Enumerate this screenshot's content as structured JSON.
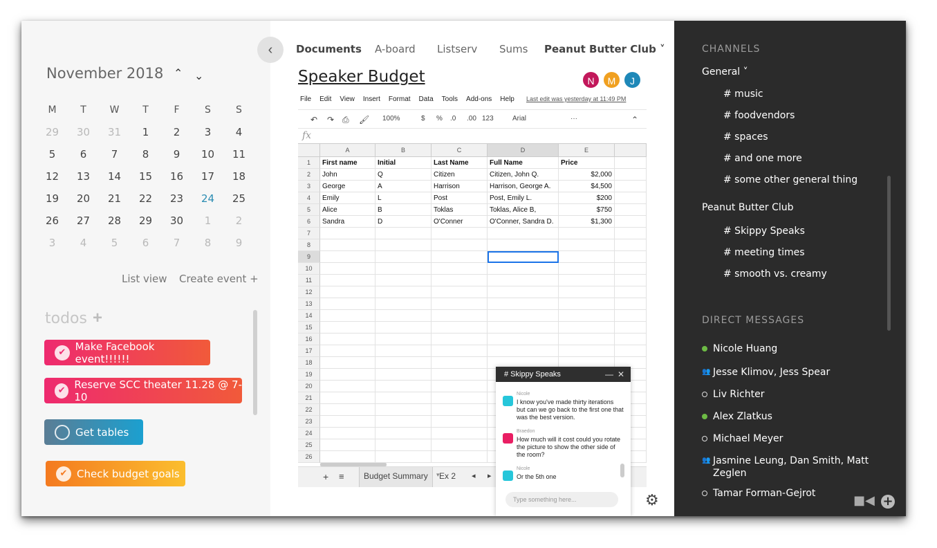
{
  "calendar": {
    "month_label": "November 2018",
    "prev": "^",
    "next": "v",
    "weekdays": [
      "M",
      "T",
      "W",
      "T",
      "F",
      "S",
      "S"
    ],
    "weeks": [
      [
        [
          "29",
          "out"
        ],
        [
          "30",
          "out"
        ],
        [
          "31",
          "out"
        ],
        [
          "1",
          "in"
        ],
        [
          "2",
          "in"
        ],
        [
          "3",
          "in"
        ],
        [
          "4",
          "in"
        ]
      ],
      [
        [
          "5",
          "in"
        ],
        [
          "6",
          "in"
        ],
        [
          "7",
          "in"
        ],
        [
          "8",
          "in"
        ],
        [
          "9",
          "in"
        ],
        [
          "10",
          "in"
        ],
        [
          "11",
          "in"
        ]
      ],
      [
        [
          "12",
          "in"
        ],
        [
          "13",
          "in"
        ],
        [
          "14",
          "in"
        ],
        [
          "15",
          "in"
        ],
        [
          "16",
          "in"
        ],
        [
          "17",
          "in"
        ],
        [
          "18",
          "in"
        ]
      ],
      [
        [
          "19",
          "in"
        ],
        [
          "20",
          "in"
        ],
        [
          "21",
          "in"
        ],
        [
          "22",
          "in"
        ],
        [
          "23",
          "in"
        ],
        [
          "24",
          "today"
        ],
        [
          "25",
          "in"
        ]
      ],
      [
        [
          "26",
          "in"
        ],
        [
          "27",
          "in"
        ],
        [
          "28",
          "in"
        ],
        [
          "29",
          "in"
        ],
        [
          "30",
          "in"
        ],
        [
          "1",
          "out"
        ],
        [
          "2",
          "out"
        ]
      ],
      [
        [
          "3",
          "out"
        ],
        [
          "4",
          "out"
        ],
        [
          "5",
          "out"
        ],
        [
          "6",
          "out"
        ],
        [
          "7",
          "out"
        ],
        [
          "8",
          "out"
        ],
        [
          "9",
          "out"
        ]
      ]
    ],
    "list_view": "List view",
    "create_event": "Create event +"
  },
  "todos": {
    "title": "todos",
    "add": "+",
    "items": [
      {
        "label": "Make Facebook event!!!!!!",
        "done": true
      },
      {
        "label": "Reserve SCC theater 11.28 @ 7-10",
        "done": true
      },
      {
        "label": "Get tables",
        "done": false
      },
      {
        "label": "Check budget goals",
        "done": true
      }
    ]
  },
  "tabs": [
    "Documents",
    "A-board",
    "Listserv",
    "Sums",
    "Peanut Butter Club ˅"
  ],
  "doc": {
    "title": "Speaker Budget",
    "avatars": [
      {
        "letter": "N",
        "color": "#c2185b"
      },
      {
        "letter": "M",
        "color": "#f0a020"
      },
      {
        "letter": "J",
        "color": "#1e88b8"
      }
    ],
    "menu": [
      "File",
      "Edit",
      "View",
      "Insert",
      "Format",
      "Data",
      "Tools",
      "Add-ons",
      "Help"
    ],
    "last_edit": "Last edit was yesterday at 11:49 PM",
    "toolbar": {
      "zoom": "100%",
      "currency": "$",
      "percent": "%",
      "dec_less": ".0",
      "dec_more": ".00",
      "format": "123",
      "font": "Arial",
      "more": "···"
    },
    "fx": "fx",
    "columns": [
      "A",
      "B",
      "C",
      "D",
      "E"
    ],
    "rows": [
      [
        "First name",
        "Initial",
        "Last Name",
        "Full Name",
        "Price"
      ],
      [
        "John",
        "Q",
        "Citizen",
        "Citizen, John Q.",
        "$2,000"
      ],
      [
        "George",
        "A",
        "Harrison",
        "Harrison, George A.",
        "$4,500"
      ],
      [
        "Emily",
        "L",
        "Post",
        "Post, Emily L.",
        "$200"
      ],
      [
        "Alice",
        "B",
        "Toklas",
        "Toklas, Alice B,",
        "$750"
      ],
      [
        "Sandra",
        "D",
        "O'Conner",
        "O'Conner, Sandra D.",
        "$1,300"
      ]
    ],
    "row_count": 26,
    "sheets": [
      "Budget Summary",
      "Ex 2"
    ]
  },
  "chat": {
    "title": "# Skippy Speaks",
    "minimize": "—",
    "close": "✕",
    "messages": [
      {
        "author": "Nicole",
        "text": "I know you've made thirty iterations but can we go back to the first one that was the best version.",
        "color": "#26c6da"
      },
      {
        "author": "Braedon",
        "text": "How much will it cost could you rotate the picture to show the other side of the room?",
        "color": "#e91e63"
      },
      {
        "author": "Nicole",
        "text": "Or the 5th one",
        "color": "#26c6da"
      }
    ],
    "placeholder": "Type something here..."
  },
  "sidebar": {
    "channels_label": "CHANNELS",
    "groups": [
      {
        "name": "General ˅",
        "channels": [
          "# music",
          "# foodvendors",
          "# spaces",
          "# and one more",
          "# some other general thing"
        ]
      },
      {
        "name": "Peanut Butter Club",
        "channels": [
          "#  Skippy Speaks",
          "# meeting times",
          "# smooth vs. creamy"
        ]
      }
    ],
    "dm_label": "DIRECT MESSAGES",
    "dms": [
      {
        "name": "Nicole Huang",
        "status": "online"
      },
      {
        "name": "Jesse Klimov, Jess Spear",
        "status": "group"
      },
      {
        "name": "Liv Richter",
        "status": "offline"
      },
      {
        "name": "Alex Zlatkus",
        "status": "online"
      },
      {
        "name": "Michael Meyer",
        "status": "offline"
      },
      {
        "name": "Jasmine Leung, Dan Smith, Matt Zeglen",
        "status": "group"
      },
      {
        "name": "Tamar Forman-Gejrot",
        "status": "offline"
      }
    ],
    "icons": [
      "video-icon",
      "add-circle-icon"
    ]
  },
  "colors": {
    "todo_gradients": [
      [
        "#ee2a6f",
        "#f15a3a"
      ],
      [
        "#ee2a6f",
        "#f15a3a"
      ],
      [
        "#5a7d95",
        "#1ba0d0"
      ],
      [
        "#f47a20",
        "#fbbe2e"
      ]
    ],
    "today": "#2a8cb2",
    "sidebar_bg": "#2b2b2b",
    "online": "#6dbb45"
  }
}
